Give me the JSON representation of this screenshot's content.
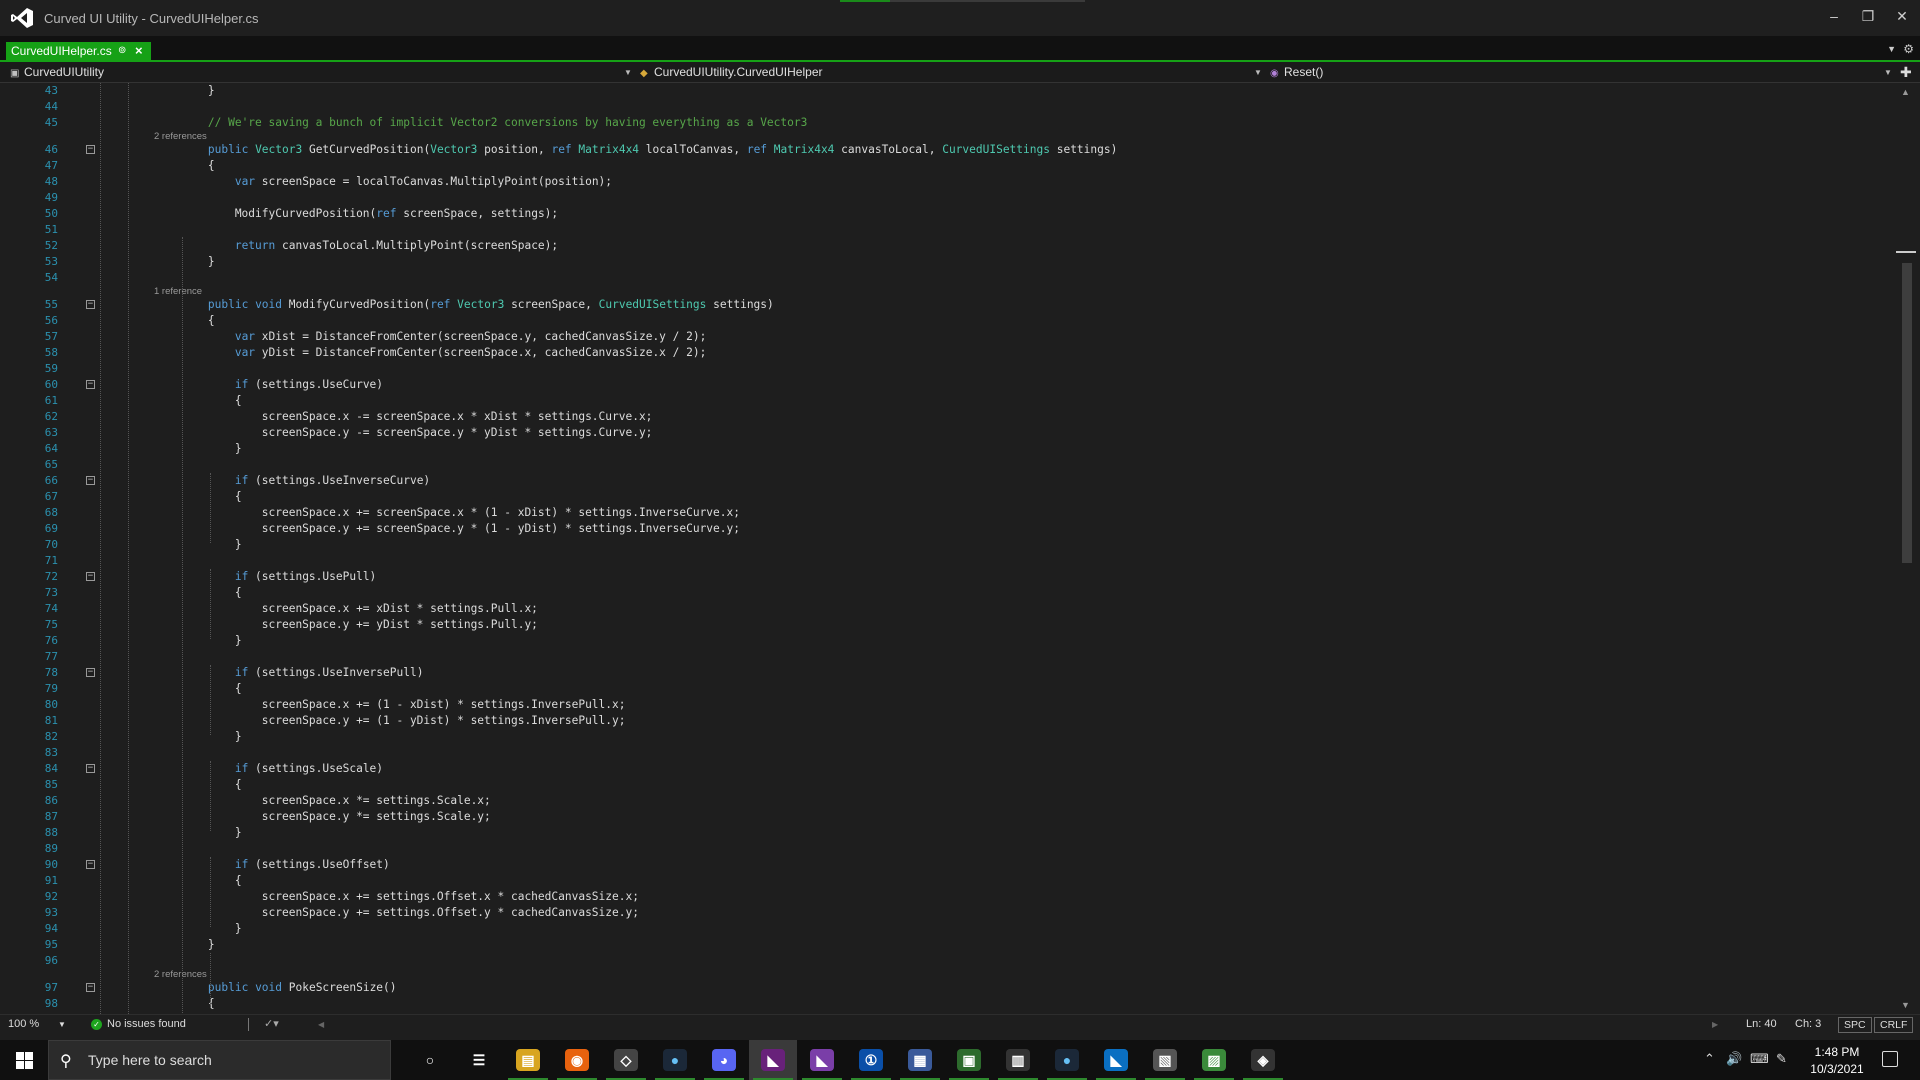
{
  "window": {
    "title": "Curved UI Utility - CurvedUIHelper.cs"
  },
  "tab": {
    "label": "CurvedUIHelper.cs"
  },
  "navbar": {
    "project": "CurvedUIUtility",
    "class": "CurvedUIUtility.CurvedUIHelper",
    "member": "Reset()"
  },
  "editor": {
    "lines": [
      {
        "n": "43",
        "text": "        }"
      },
      {
        "n": "44",
        "text": ""
      },
      {
        "n": "45",
        "text": "        // We're saving a bunch of implicit Vector2 conversions by having everything as a Vector3"
      },
      {
        "n": "46",
        "ref": "2 references",
        "text": "        public Vector3 GetCurvedPosition(Vector3 position, ref Matrix4x4 localToCanvas, ref Matrix4x4 canvasToLocal, CurvedUISettings settings)",
        "fold": true
      },
      {
        "n": "47",
        "text": "        {"
      },
      {
        "n": "48",
        "text": "            var screenSpace = localToCanvas.MultiplyPoint(position);"
      },
      {
        "n": "49",
        "text": ""
      },
      {
        "n": "50",
        "text": "            ModifyCurvedPosition(ref screenSpace, settings);"
      },
      {
        "n": "51",
        "text": ""
      },
      {
        "n": "52",
        "text": "            return canvasToLocal.MultiplyPoint(screenSpace);"
      },
      {
        "n": "53",
        "text": "        }"
      },
      {
        "n": "54",
        "text": ""
      },
      {
        "n": "55",
        "ref": "1 reference",
        "text": "        public void ModifyCurvedPosition(ref Vector3 screenSpace, CurvedUISettings settings)",
        "fold": true
      },
      {
        "n": "56",
        "text": "        {"
      },
      {
        "n": "57",
        "text": "            var xDist = DistanceFromCenter(screenSpace.y, cachedCanvasSize.y / 2);"
      },
      {
        "n": "58",
        "text": "            var yDist = DistanceFromCenter(screenSpace.x, cachedCanvasSize.x / 2);"
      },
      {
        "n": "59",
        "text": ""
      },
      {
        "n": "60",
        "text": "            if (settings.UseCurve)",
        "fold": true
      },
      {
        "n": "61",
        "text": "            {"
      },
      {
        "n": "62",
        "text": "                screenSpace.x -= screenSpace.x * xDist * settings.Curve.x;"
      },
      {
        "n": "63",
        "text": "                screenSpace.y -= screenSpace.y * yDist * settings.Curve.y;"
      },
      {
        "n": "64",
        "text": "            }"
      },
      {
        "n": "65",
        "text": ""
      },
      {
        "n": "66",
        "text": "            if (settings.UseInverseCurve)",
        "fold": true
      },
      {
        "n": "67",
        "text": "            {"
      },
      {
        "n": "68",
        "text": "                screenSpace.x += screenSpace.x * (1 - xDist) * settings.InverseCurve.x;"
      },
      {
        "n": "69",
        "text": "                screenSpace.y += screenSpace.y * (1 - yDist) * settings.InverseCurve.y;"
      },
      {
        "n": "70",
        "text": "            }"
      },
      {
        "n": "71",
        "text": ""
      },
      {
        "n": "72",
        "text": "            if (settings.UsePull)",
        "fold": true
      },
      {
        "n": "73",
        "text": "            {"
      },
      {
        "n": "74",
        "text": "                screenSpace.x += xDist * settings.Pull.x;"
      },
      {
        "n": "75",
        "text": "                screenSpace.y += yDist * settings.Pull.y;"
      },
      {
        "n": "76",
        "text": "            }"
      },
      {
        "n": "77",
        "text": ""
      },
      {
        "n": "78",
        "text": "            if (settings.UseInversePull)",
        "fold": true
      },
      {
        "n": "79",
        "text": "            {"
      },
      {
        "n": "80",
        "text": "                screenSpace.x += (1 - xDist) * settings.InversePull.x;"
      },
      {
        "n": "81",
        "text": "                screenSpace.y += (1 - yDist) * settings.InversePull.y;"
      },
      {
        "n": "82",
        "text": "            }"
      },
      {
        "n": "83",
        "text": ""
      },
      {
        "n": "84",
        "text": "            if (settings.UseScale)",
        "fold": true
      },
      {
        "n": "85",
        "text": "            {"
      },
      {
        "n": "86",
        "text": "                screenSpace.x *= settings.Scale.x;"
      },
      {
        "n": "87",
        "text": "                screenSpace.y *= settings.Scale.y;"
      },
      {
        "n": "88",
        "text": "            }"
      },
      {
        "n": "89",
        "text": ""
      },
      {
        "n": "90",
        "text": "            if (settings.UseOffset)",
        "fold": true
      },
      {
        "n": "91",
        "text": "            {"
      },
      {
        "n": "92",
        "text": "                screenSpace.x += settings.Offset.x * cachedCanvasSize.x;"
      },
      {
        "n": "93",
        "text": "                screenSpace.y += settings.Offset.y * cachedCanvasSize.y;"
      },
      {
        "n": "94",
        "text": "            }"
      },
      {
        "n": "95",
        "text": "        }"
      },
      {
        "n": "96",
        "text": ""
      },
      {
        "n": "97",
        "ref": "2 references",
        "text": "        public void PokeScreenSize()",
        "fold": true
      },
      {
        "n": "98",
        "text": "        {"
      }
    ]
  },
  "status": {
    "zoom": "100 %",
    "issues": "No issues found",
    "line": "Ln: 40",
    "char": "Ch: 3",
    "spacing": "SPC",
    "line_ending": "CRLF"
  },
  "taskbar": {
    "search_placeholder": "Type here to search",
    "apps": [
      "cortana-icon",
      "task-view-icon",
      "file-explorer-icon",
      "firefox-icon",
      "unity-hub-icon",
      "steam-icon",
      "discord-icon",
      "visual-studio-icon",
      "visual-studio-2-icon",
      "1password-icon",
      "app-icon",
      "app-icon-2",
      "app-icon-3",
      "steam-2-icon",
      "vscode-icon",
      "app-icon-4",
      "notepad-icon",
      "unity-icon"
    ],
    "time": "1:48 PM",
    "date": "10/3/2021"
  },
  "colors": {
    "accent": "#16a116",
    "keyword": "#569cd6",
    "type": "#4ec9b0",
    "comment": "#57a64a",
    "line_number": "#2b91af"
  }
}
